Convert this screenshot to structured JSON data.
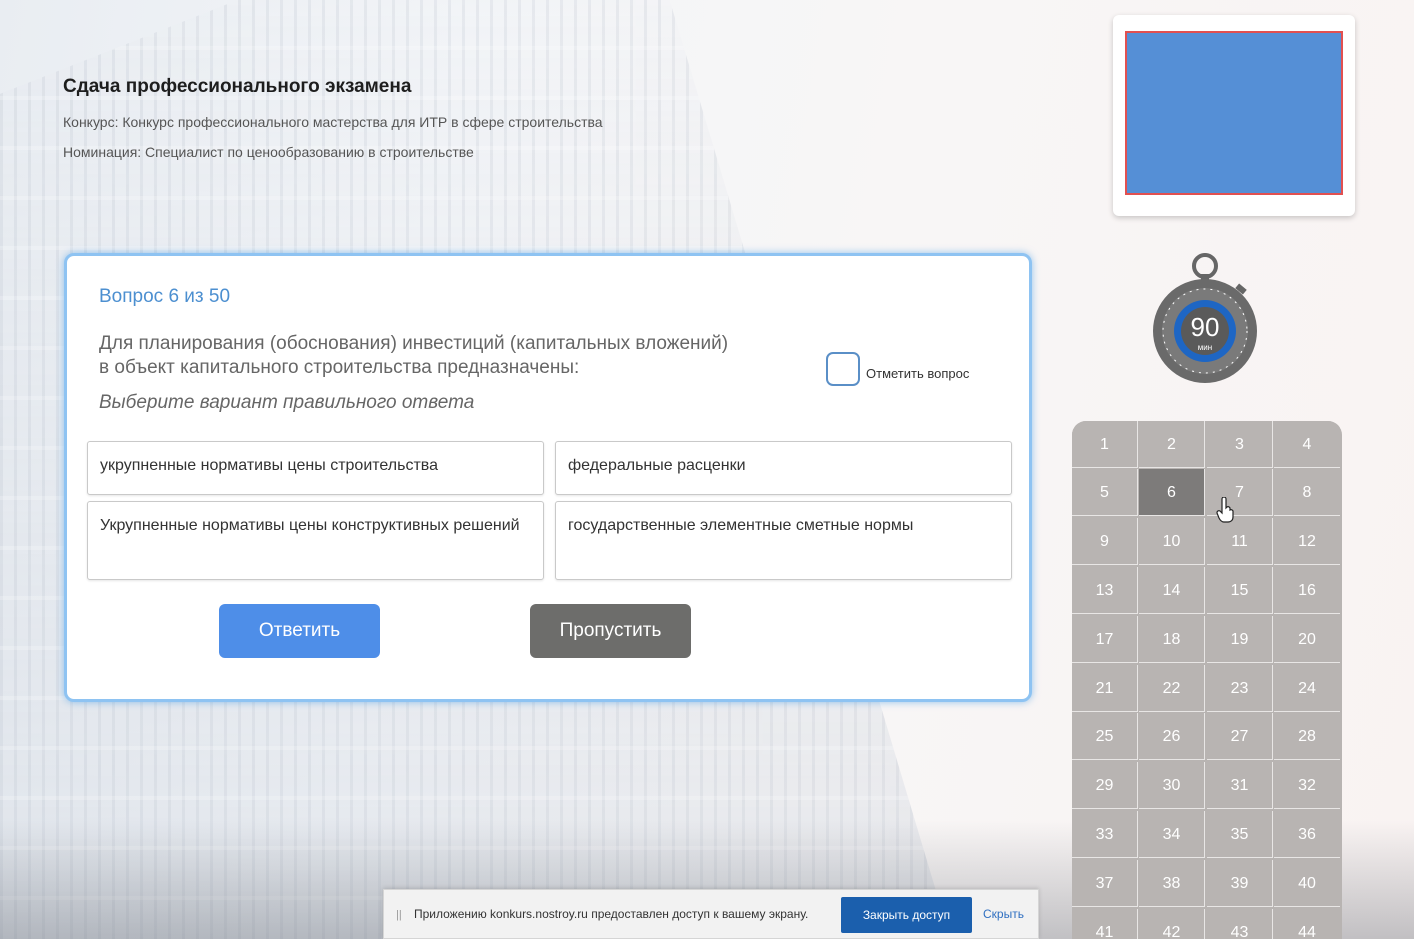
{
  "header": {
    "title": "Сдача профессионального экзамена",
    "contest": "Конкурс: Конкурс профессионального мастерства для ИТР в сфере строительства",
    "nomination": "Номинация: Специалист по ценообразованию в строительстве"
  },
  "timer": {
    "value": "90",
    "unit": "мин"
  },
  "question": {
    "counter": "Вопрос 6 из 50",
    "text": "Для планирования (обоснования) инвестиций (капитальных вложений) в объект капитального строительства предназначены:",
    "hint": "Выберите вариант правильного ответа",
    "mark_label": "Отметить вопрос",
    "options": [
      "укрупненные нормативы цены строительства",
      "федеральные расценки",
      "Укрупненные нормативы цены конструктивных решений",
      "государственные элементные сметные нормы"
    ],
    "answer_label": "Ответить",
    "skip_label": "Пропустить"
  },
  "navigator": {
    "current": 6,
    "numbers": [
      "1",
      "2",
      "3",
      "4",
      "5",
      "6",
      "7",
      "8",
      "9",
      "10",
      "11",
      "12",
      "13",
      "14",
      "15",
      "16",
      "17",
      "18",
      "19",
      "20",
      "21",
      "22",
      "23",
      "24",
      "25",
      "26",
      "27",
      "28",
      "29",
      "30",
      "31",
      "32",
      "33",
      "34",
      "35",
      "36",
      "37",
      "38",
      "39",
      "40",
      "41",
      "42",
      "43",
      "44"
    ]
  },
  "share_bar": {
    "grip": "||",
    "message": "Приложению konkurs.nostroy.ru предоставлен доступ к вашему экрану.",
    "stop_label": "Закрыть доступ",
    "hide_label": "Скрыть"
  },
  "colors": {
    "accent": "#4e8ee8",
    "skip": "#6d6d6b",
    "video_fill": "#558fd6",
    "video_border": "#e25050",
    "grid_cell": "#b8b4b2",
    "grid_current": "#7d7b7a"
  }
}
